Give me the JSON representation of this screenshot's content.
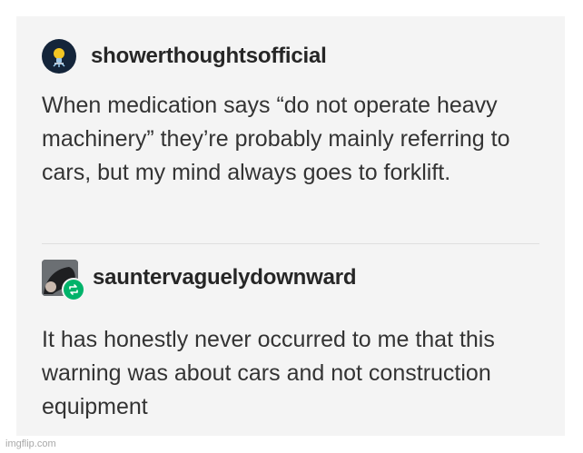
{
  "posts": [
    {
      "username": "showerthoughtsofficial",
      "avatar_icon": "lightbulb-icon",
      "text": "When medication says “do not operate heavy machinery” they’re probably mainly referring to cars, but my mind always goes to forklift."
    },
    {
      "username": "sauntervaguelydownward",
      "avatar_icon": "user-photo-avatar",
      "badge_icon": "reblog-icon",
      "text": "It has honestly never occurred to me that this warning was about cars and not construction equipment"
    }
  ],
  "watermark": "imgflip.com",
  "colors": {
    "background": "#f4f4f4",
    "text": "#333333",
    "reblog_badge": "#00b36a"
  }
}
